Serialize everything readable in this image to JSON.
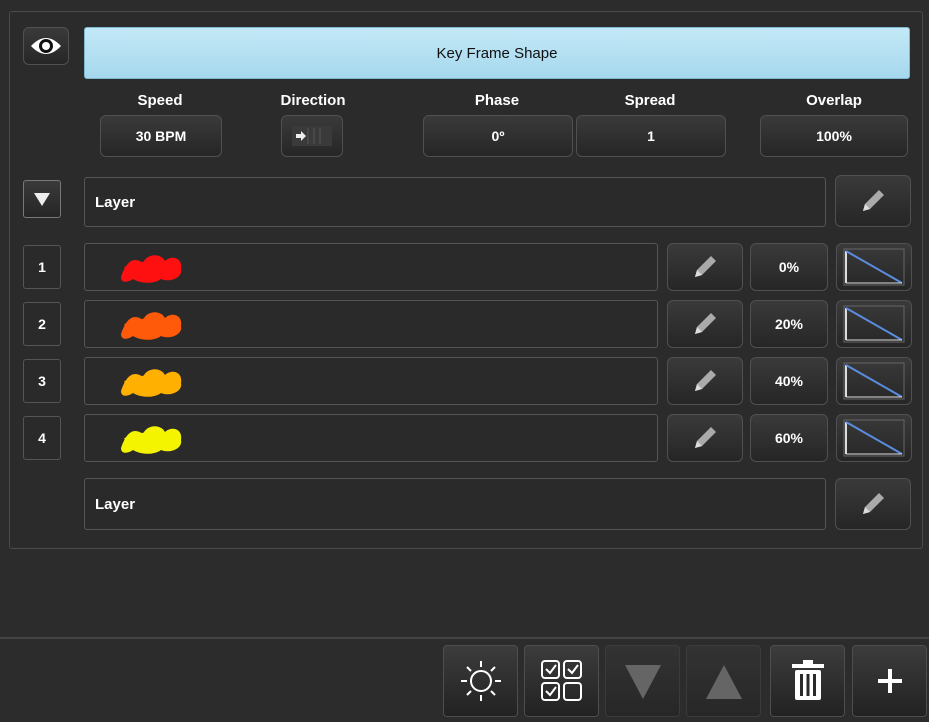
{
  "header": {
    "title": "Key Frame Shape",
    "eye_icon": "eye-icon"
  },
  "params": {
    "speed_label": "Speed",
    "speed_value": "30 BPM",
    "direction_label": "Direction",
    "phase_label": "Phase",
    "phase_value": "0º",
    "spread_label": "Spread",
    "spread_value": "1",
    "overlap_label": "Overlap",
    "overlap_value": "100%"
  },
  "layer_header": {
    "label": "Layer"
  },
  "rows": [
    {
      "num": "1",
      "color": "#ff1010",
      "percent": "0%"
    },
    {
      "num": "2",
      "color": "#ff5a0a",
      "percent": "20%"
    },
    {
      "num": "3",
      "color": "#ffb000",
      "percent": "40%"
    },
    {
      "num": "4",
      "color": "#f4f400",
      "percent": "60%"
    }
  ],
  "layer_footer": {
    "label": "Layer"
  },
  "toolbar": {
    "icons": [
      "brightness-icon",
      "select-grid-icon",
      "move-down-icon",
      "move-up-icon",
      "delete-icon",
      "add-icon"
    ]
  }
}
